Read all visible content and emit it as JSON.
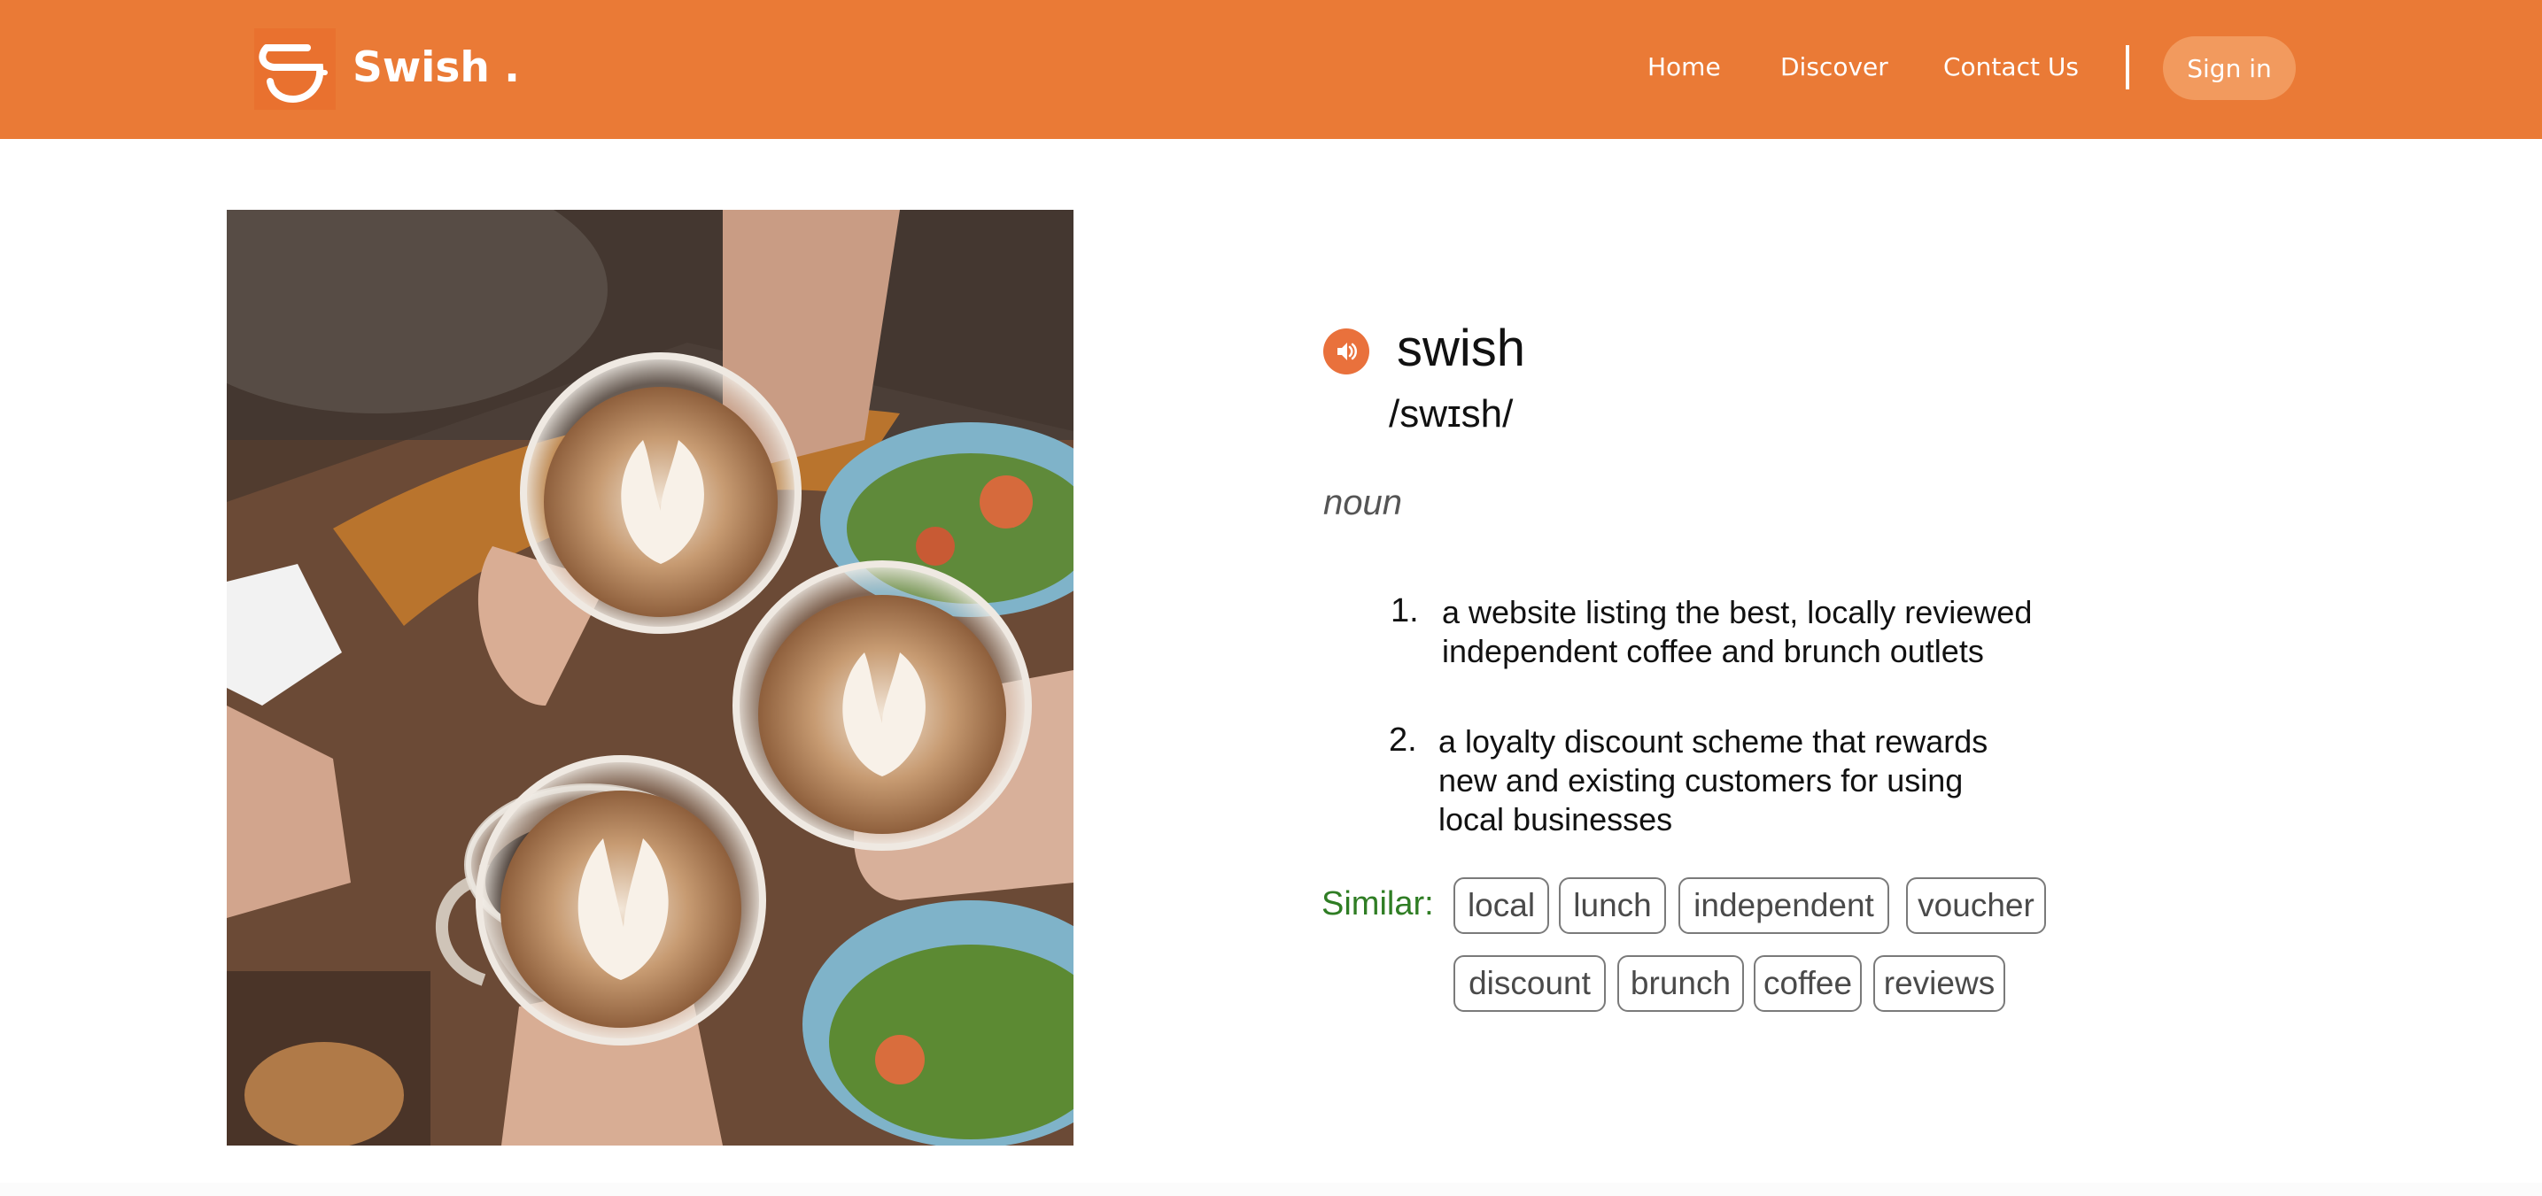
{
  "brand": {
    "name": "Swish .",
    "logo_icon": "coffee-cup-icon",
    "color": "#ea7a36"
  },
  "nav": {
    "home": "Home",
    "discover": "Discover",
    "contact": "Contact Us",
    "signin": "Sign in"
  },
  "hero": {
    "image": "four-coffee-cups-cheers-photo"
  },
  "definition": {
    "speaker_icon": "speaker-icon",
    "word": "swish",
    "pronunciation": "/swɪsh/",
    "part_of_speech": "noun",
    "senses": [
      {
        "num": "1.",
        "text": "a website listing the best, locally reviewed\nindependent coffee and brunch outlets"
      },
      {
        "num": "2.",
        "text": "a loyalty discount scheme that rewards\nnew and existing customers for using\nlocal businesses"
      }
    ],
    "similar_label": "Similar:",
    "similar": [
      "local",
      "lunch",
      "independent",
      "voucher",
      "discount",
      "brunch",
      "coffee",
      "reviews"
    ]
  },
  "colors": {
    "accent": "#e9713c",
    "similar_label": "#2f7d24",
    "signin_button": "#f29a5e"
  }
}
